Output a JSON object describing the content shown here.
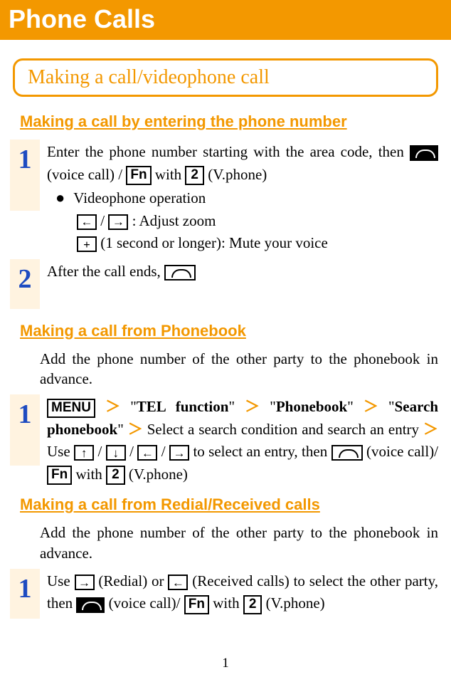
{
  "banner": "Phone Calls",
  "section_title": "Making a call/videophone call",
  "heading1": "Making a call by entering the phone number",
  "heading2": "Making a call from Phonebook",
  "heading3": "Making a call from Redial/Received calls",
  "s1": {
    "num": "1",
    "line1a": "Enter the phone number starting with the area code, then ",
    "line1b": "(voice call) / ",
    "fn": "Fn",
    "with": " with ",
    "two": "2",
    "vphone": " (V.phone)",
    "bullet": "Videophone operation",
    "sub1a": " / ",
    "sub1b": " : Adjust zoom",
    "sub2": "(1 second or longer): Mute your voice"
  },
  "s2": {
    "num": "2",
    "text": "After the call ends, "
  },
  "phonebook": {
    "intro": "Add the phone number of the other party to the phonebook in advance.",
    "num": "1",
    "menu": "MENU",
    "t1": "TEL  function",
    "t2": "Phonebook",
    "t3": "Search phonebook",
    "q1": "\"",
    "gt": "＞",
    "mid1": "Select a search condition and search an entry ",
    "use": "Use ",
    "slash": " / ",
    "mid2": " to select an entry, then ",
    "vc": " (voice call)/ ",
    "fn": "Fn",
    "with": " with ",
    "two": "2",
    "vp": " (V.phone)"
  },
  "redial": {
    "intro": "Add the phone number of the other party to the phonebook in advance.",
    "num": "1",
    "use": "Use ",
    "r1": " (Redial) or ",
    "r2": " (Received calls) to select the other party, then ",
    "vc": "(voice call)/ ",
    "fn": "Fn",
    "with": " with ",
    "two": "2",
    "vp": " (V.phone)"
  },
  "page_number": "1"
}
